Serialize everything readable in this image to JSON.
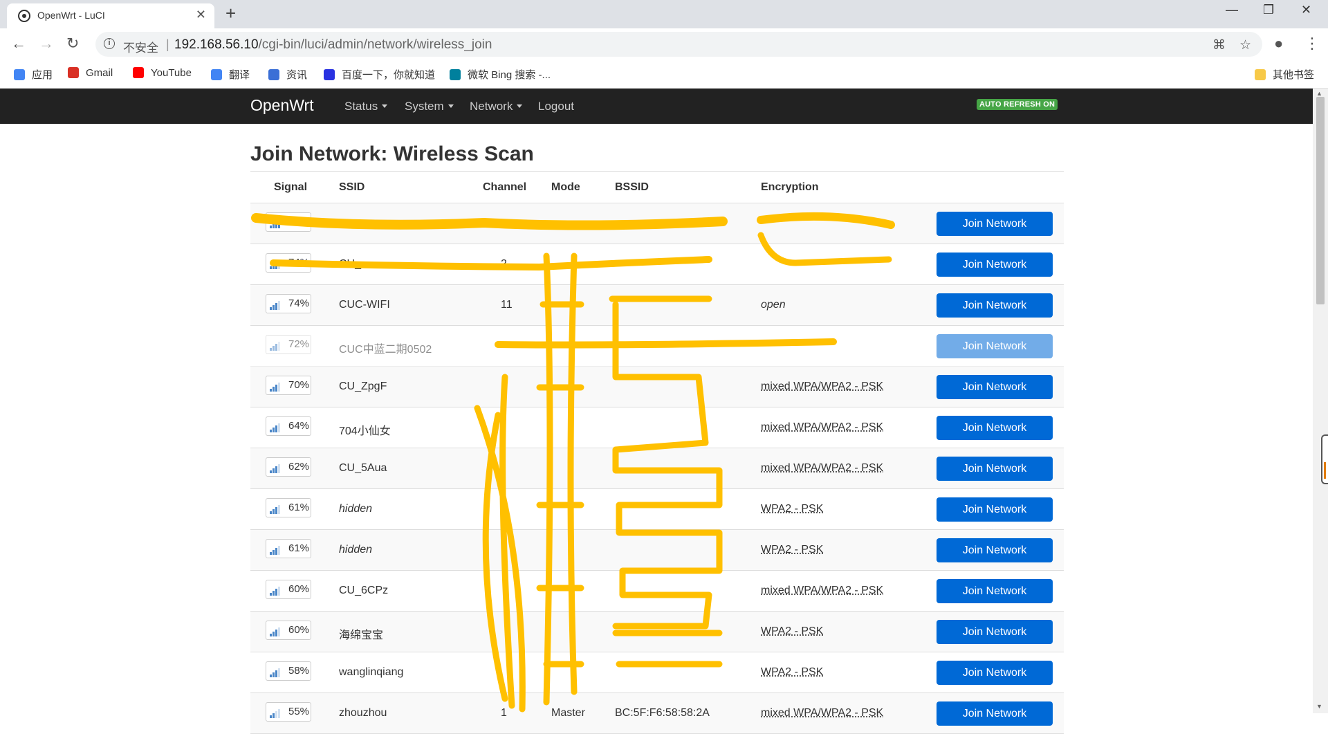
{
  "browser": {
    "tab_title": "OpenWrt - LuCI",
    "tab_close": "✕",
    "new_tab": "+",
    "insecure_label": "不安全",
    "separator": "|",
    "url_host": "192.168.56.10",
    "url_path": "/cgi-bin/luci/admin/network/wireless_join",
    "window_controls": {
      "minimize": "—",
      "maximize": "❐",
      "close": "✕"
    },
    "bookmarks": [
      {
        "label": "应用",
        "icon": "apps-grid-icon",
        "color": "#4285f4"
      },
      {
        "label": "Gmail",
        "icon": "gmail-icon",
        "color": "#d93025"
      },
      {
        "label": "YouTube",
        "icon": "youtube-icon",
        "color": "#ff0000"
      },
      {
        "label": "翻译",
        "icon": "translate-icon",
        "color": "#4285f4"
      },
      {
        "label": "资讯",
        "icon": "news-icon",
        "color": "#3b6fd6"
      },
      {
        "label": "百度一下，你就知道",
        "icon": "baidu-paw-icon",
        "color": "#2932e1"
      },
      {
        "label": "微软 Bing 搜索 -...",
        "icon": "bing-icon",
        "color": "#00809d"
      }
    ],
    "other_bookmarks": "其他书签"
  },
  "nav": {
    "brand": "OpenWrt",
    "menu": [
      "Status",
      "System",
      "Network",
      "Logout"
    ],
    "auto_refresh": "AUTO REFRESH ON"
  },
  "page": {
    "title": "Join Network: Wireless Scan",
    "headers": {
      "signal": "Signal",
      "ssid": "SSID",
      "channel": "Channel",
      "mode": "Mode",
      "bssid": "BSSID",
      "encryption": "Encryption"
    },
    "join_label": "Join Network",
    "rows": [
      {
        "signal": "95%",
        "ssid": "",
        "channel": "",
        "mode": "",
        "bssid": "",
        "encryption": "",
        "level": 4
      },
      {
        "signal": "74%",
        "ssid": "CU_",
        "channel": "2",
        "mode": "",
        "bssid": "",
        "encryption": "",
        "level": 3
      },
      {
        "signal": "74%",
        "ssid": "CUC-WIFI",
        "channel": "11",
        "mode": "",
        "bssid": "",
        "encryption": "open",
        "level": 3
      },
      {
        "signal": "72%",
        "ssid": "CUC中蓝二期0502",
        "channel": "",
        "mode": "",
        "bssid": "",
        "encryption": "",
        "level": 3
      },
      {
        "signal": "70%",
        "ssid": "CU_ZpgF",
        "channel": "",
        "mode": "",
        "bssid": "",
        "encryption": "mixed WPA/WPA2 - PSK",
        "level": 3
      },
      {
        "signal": "64%",
        "ssid": "704小仙女",
        "channel": "",
        "mode": "",
        "bssid": "",
        "encryption": "mixed WPA/WPA2 - PSK",
        "level": 3
      },
      {
        "signal": "62%",
        "ssid": "CU_5Aua",
        "channel": "",
        "mode": "",
        "bssid": "",
        "encryption": "mixed WPA/WPA2 - PSK",
        "level": 3
      },
      {
        "signal": "61%",
        "ssid": "hidden",
        "channel": "",
        "mode": "",
        "bssid": "",
        "encryption": "WPA2 - PSK",
        "level": 3
      },
      {
        "signal": "61%",
        "ssid": "hidden",
        "channel": "",
        "mode": "",
        "bssid": "",
        "encryption": "WPA2 - PSK",
        "level": 3
      },
      {
        "signal": "60%",
        "ssid": "CU_6CPz",
        "channel": "",
        "mode": "",
        "bssid": "",
        "encryption": "mixed WPA/WPA2 - PSK",
        "level": 3
      },
      {
        "signal": "60%",
        "ssid": "海绵宝宝",
        "channel": "",
        "mode": "",
        "bssid": "",
        "encryption": "WPA2 - PSK",
        "level": 3
      },
      {
        "signal": "58%",
        "ssid": "wanglinqiang",
        "channel": "",
        "mode": "",
        "bssid": "",
        "encryption": "WPA2 - PSK",
        "level": 3
      },
      {
        "signal": "55%",
        "ssid": "zhouzhou",
        "channel": "1",
        "mode": "Master",
        "bssid": "BC:5F:F6:58:58:2A",
        "encryption": "mixed WPA/WPA2 - PSK",
        "level": 2
      }
    ]
  },
  "colors": {
    "navbar": "#222222",
    "join_button": "#0069d6",
    "auto_refresh": "#46a546",
    "redaction": "#ffc000"
  }
}
